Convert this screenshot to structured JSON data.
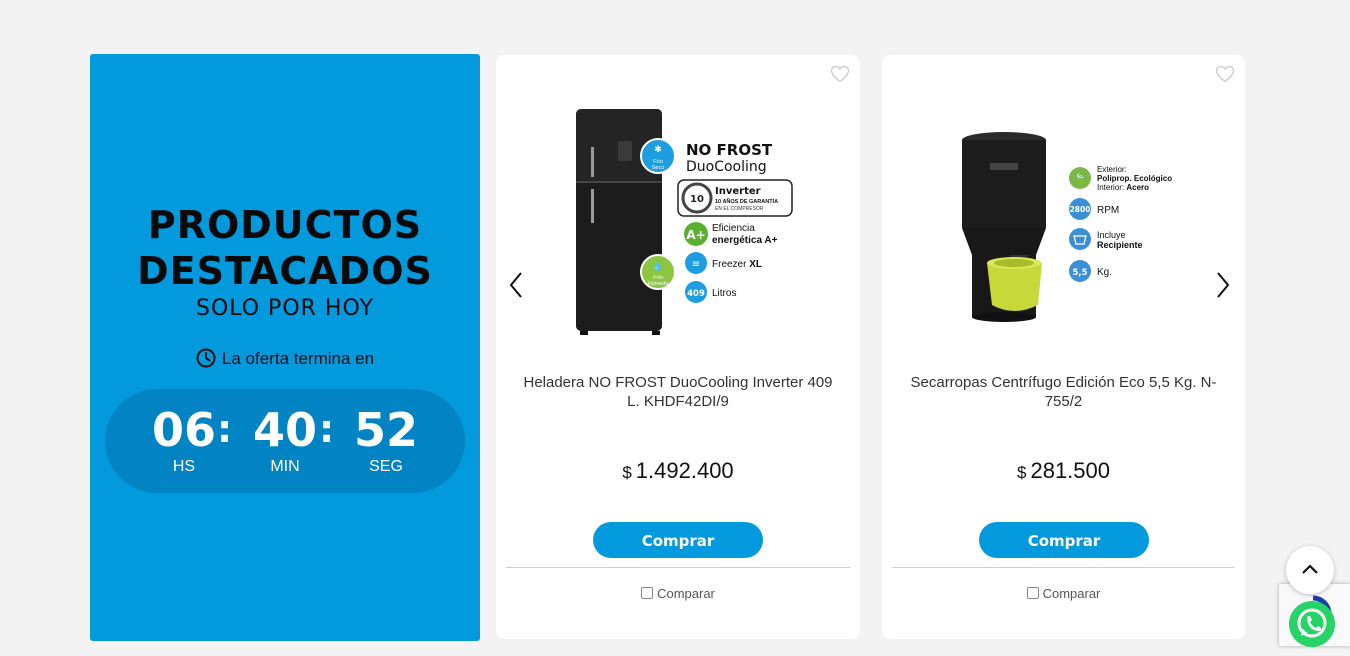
{
  "promo": {
    "title_line1": "PRODUCTOS",
    "title_line2": "DESTACADOS",
    "subtitle": "SOLO POR HOY",
    "offer_text": "La oferta termina en",
    "timer": {
      "hours": "06",
      "hours_label": "HS",
      "minutes": "40",
      "minutes_label": "MIN",
      "seconds": "52",
      "seconds_label": "SEG",
      "separator": ":"
    }
  },
  "products": [
    {
      "name": "Heladera NO FROST DuoCooling Inverter 409 L. KHDF42DI/9",
      "currency": "$",
      "price": "1.492.400",
      "buy_label": "Comprar",
      "compare_label": "Comparar",
      "image": {
        "headline1": "NO FROST",
        "headline2": "DuoCooling",
        "badge_inverter": "Inverter",
        "badge_warranty": "10 AÑOS DE GARANTÍA",
        "badge_compressor": "EN EL COMPRESOR",
        "badge_years": "10",
        "efficiency_grade": "A+",
        "efficiency_line1": "Eficiencia",
        "efficiency_line2": "energética A+",
        "freezer_label": "Freezer",
        "freezer_size": "XL",
        "litres_value": "409",
        "litres_label": "Litros",
        "cold_dry_line1": "Frío",
        "cold_dry_line2": "Seco",
        "cold_humid_line1": "Frío",
        "cold_humid_line2": "Húmedo"
      }
    },
    {
      "name": "Secarropas Centrífugo Edición Eco 5,5 Kg. N-755/2",
      "currency": "$",
      "price": "281.500",
      "buy_label": "Comprar",
      "compare_label": "Comparar",
      "image": {
        "exterior_label": "Exterior:",
        "exterior_value": "Poliprop. Ecológico",
        "interior_label": "Interior:",
        "interior_value": "Acero",
        "rpm_value": "2800",
        "rpm_label": "RPM",
        "recipient_line1": "Incluye",
        "recipient_line2": "Recipiente",
        "kg_value": "5,5",
        "kg_label": "Kg."
      }
    }
  ],
  "colors": {
    "accent": "#0399dd",
    "timer_bg": "#0283c4",
    "page_bg": "#f3f3f3",
    "eco_green": "#7ab648",
    "feature_blue": "#3b8fd4"
  },
  "icons": [
    "clock-icon",
    "heart-icon",
    "chevron-left-icon",
    "chevron-right-icon",
    "chevron-up-icon",
    "whatsapp-icon",
    "recaptcha-icon"
  ]
}
